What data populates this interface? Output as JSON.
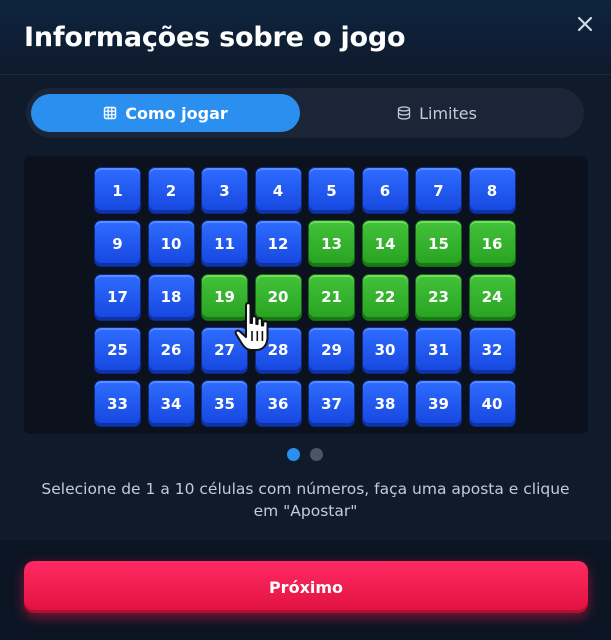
{
  "header": {
    "title": "Informações sobre o jogo",
    "close_icon": "close-icon"
  },
  "tabs": [
    {
      "label": "Como jogar",
      "icon": "grid-icon",
      "active": true
    },
    {
      "label": "Limites",
      "icon": "database-icon",
      "active": false
    }
  ],
  "board": {
    "cells": [
      {
        "n": "1",
        "state": "blue"
      },
      {
        "n": "2",
        "state": "blue"
      },
      {
        "n": "3",
        "state": "blue"
      },
      {
        "n": "4",
        "state": "blue"
      },
      {
        "n": "5",
        "state": "blue"
      },
      {
        "n": "6",
        "state": "blue"
      },
      {
        "n": "7",
        "state": "blue"
      },
      {
        "n": "8",
        "state": "blue"
      },
      {
        "n": "9",
        "state": "blue"
      },
      {
        "n": "10",
        "state": "blue"
      },
      {
        "n": "11",
        "state": "blue"
      },
      {
        "n": "12",
        "state": "blue"
      },
      {
        "n": "13",
        "state": "green"
      },
      {
        "n": "14",
        "state": "green"
      },
      {
        "n": "15",
        "state": "green"
      },
      {
        "n": "16",
        "state": "green"
      },
      {
        "n": "17",
        "state": "blue"
      },
      {
        "n": "18",
        "state": "blue"
      },
      {
        "n": "19",
        "state": "green"
      },
      {
        "n": "20",
        "state": "green"
      },
      {
        "n": "21",
        "state": "green"
      },
      {
        "n": "22",
        "state": "green"
      },
      {
        "n": "23",
        "state": "green"
      },
      {
        "n": "24",
        "state": "green"
      },
      {
        "n": "25",
        "state": "blue"
      },
      {
        "n": "26",
        "state": "blue"
      },
      {
        "n": "27",
        "state": "blue"
      },
      {
        "n": "28",
        "state": "blue"
      },
      {
        "n": "29",
        "state": "blue"
      },
      {
        "n": "30",
        "state": "blue"
      },
      {
        "n": "31",
        "state": "blue"
      },
      {
        "n": "32",
        "state": "blue"
      },
      {
        "n": "33",
        "state": "blue"
      },
      {
        "n": "34",
        "state": "blue"
      },
      {
        "n": "35",
        "state": "blue"
      },
      {
        "n": "36",
        "state": "blue"
      },
      {
        "n": "37",
        "state": "blue"
      },
      {
        "n": "38",
        "state": "blue"
      },
      {
        "n": "39",
        "state": "blue"
      },
      {
        "n": "40",
        "state": "blue"
      }
    ],
    "cursor_icon": "hand-pointer-icon"
  },
  "pagination": {
    "current": 1,
    "total": 2
  },
  "description": "Selecione de 1 a 10 células com números, faça uma aposta e clique em \"Apostar\"",
  "footer": {
    "next_label": "Próximo"
  },
  "colors": {
    "accent": "#2b8ff0",
    "cell_blue": "#1f5af0",
    "cell_green": "#33b12c",
    "next_button": "#f01a4e"
  }
}
